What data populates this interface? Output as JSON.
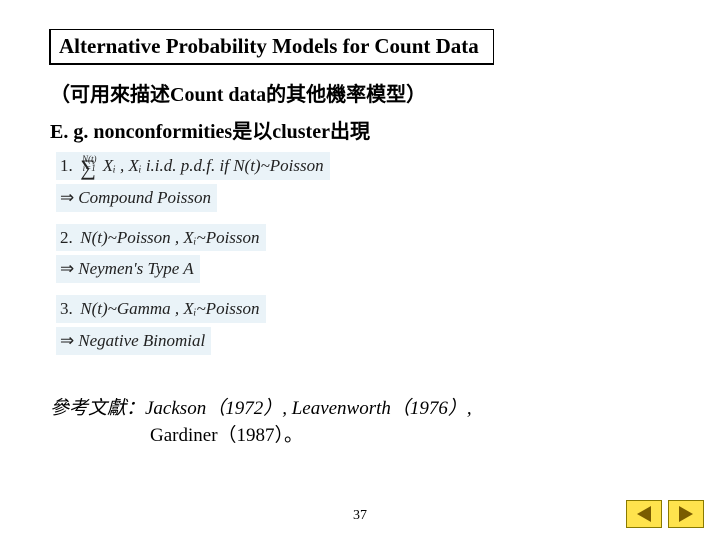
{
  "title": "Alternative Probability Models for Count Data",
  "subtitle": "（可用來描述Count data的其他機率模型）",
  "eg": "E. g. nonconformities是以cluster出現",
  "math": {
    "l1a_num": "1.",
    "l1a": "∑",
    "l1a_top": "N(t)",
    "l1a_bot": "i=1",
    "l1a_rest": " Xᵢ ,  Xᵢ  i.i.d.  p.d.f.  if  N(t)~Poisson",
    "l1b": "Compound Poisson",
    "l2a_num": "2.",
    "l2a": " N(t)~Poisson ,  Xᵢ~Poisson",
    "l2b": "Neymen's Type A",
    "l3a_num": "3.",
    "l3a": " N(t)~Gamma ,  Xᵢ~Poisson",
    "l3b": "Negative Binomial",
    "imply": "⇒"
  },
  "refs": {
    "line1": "參考文獻：Jackson（1972）, Leavenworth（1976）,",
    "line2": "Gardiner（1987）。"
  },
  "pagenum": "37",
  "nav": {
    "prev": "previous",
    "next": "next"
  }
}
